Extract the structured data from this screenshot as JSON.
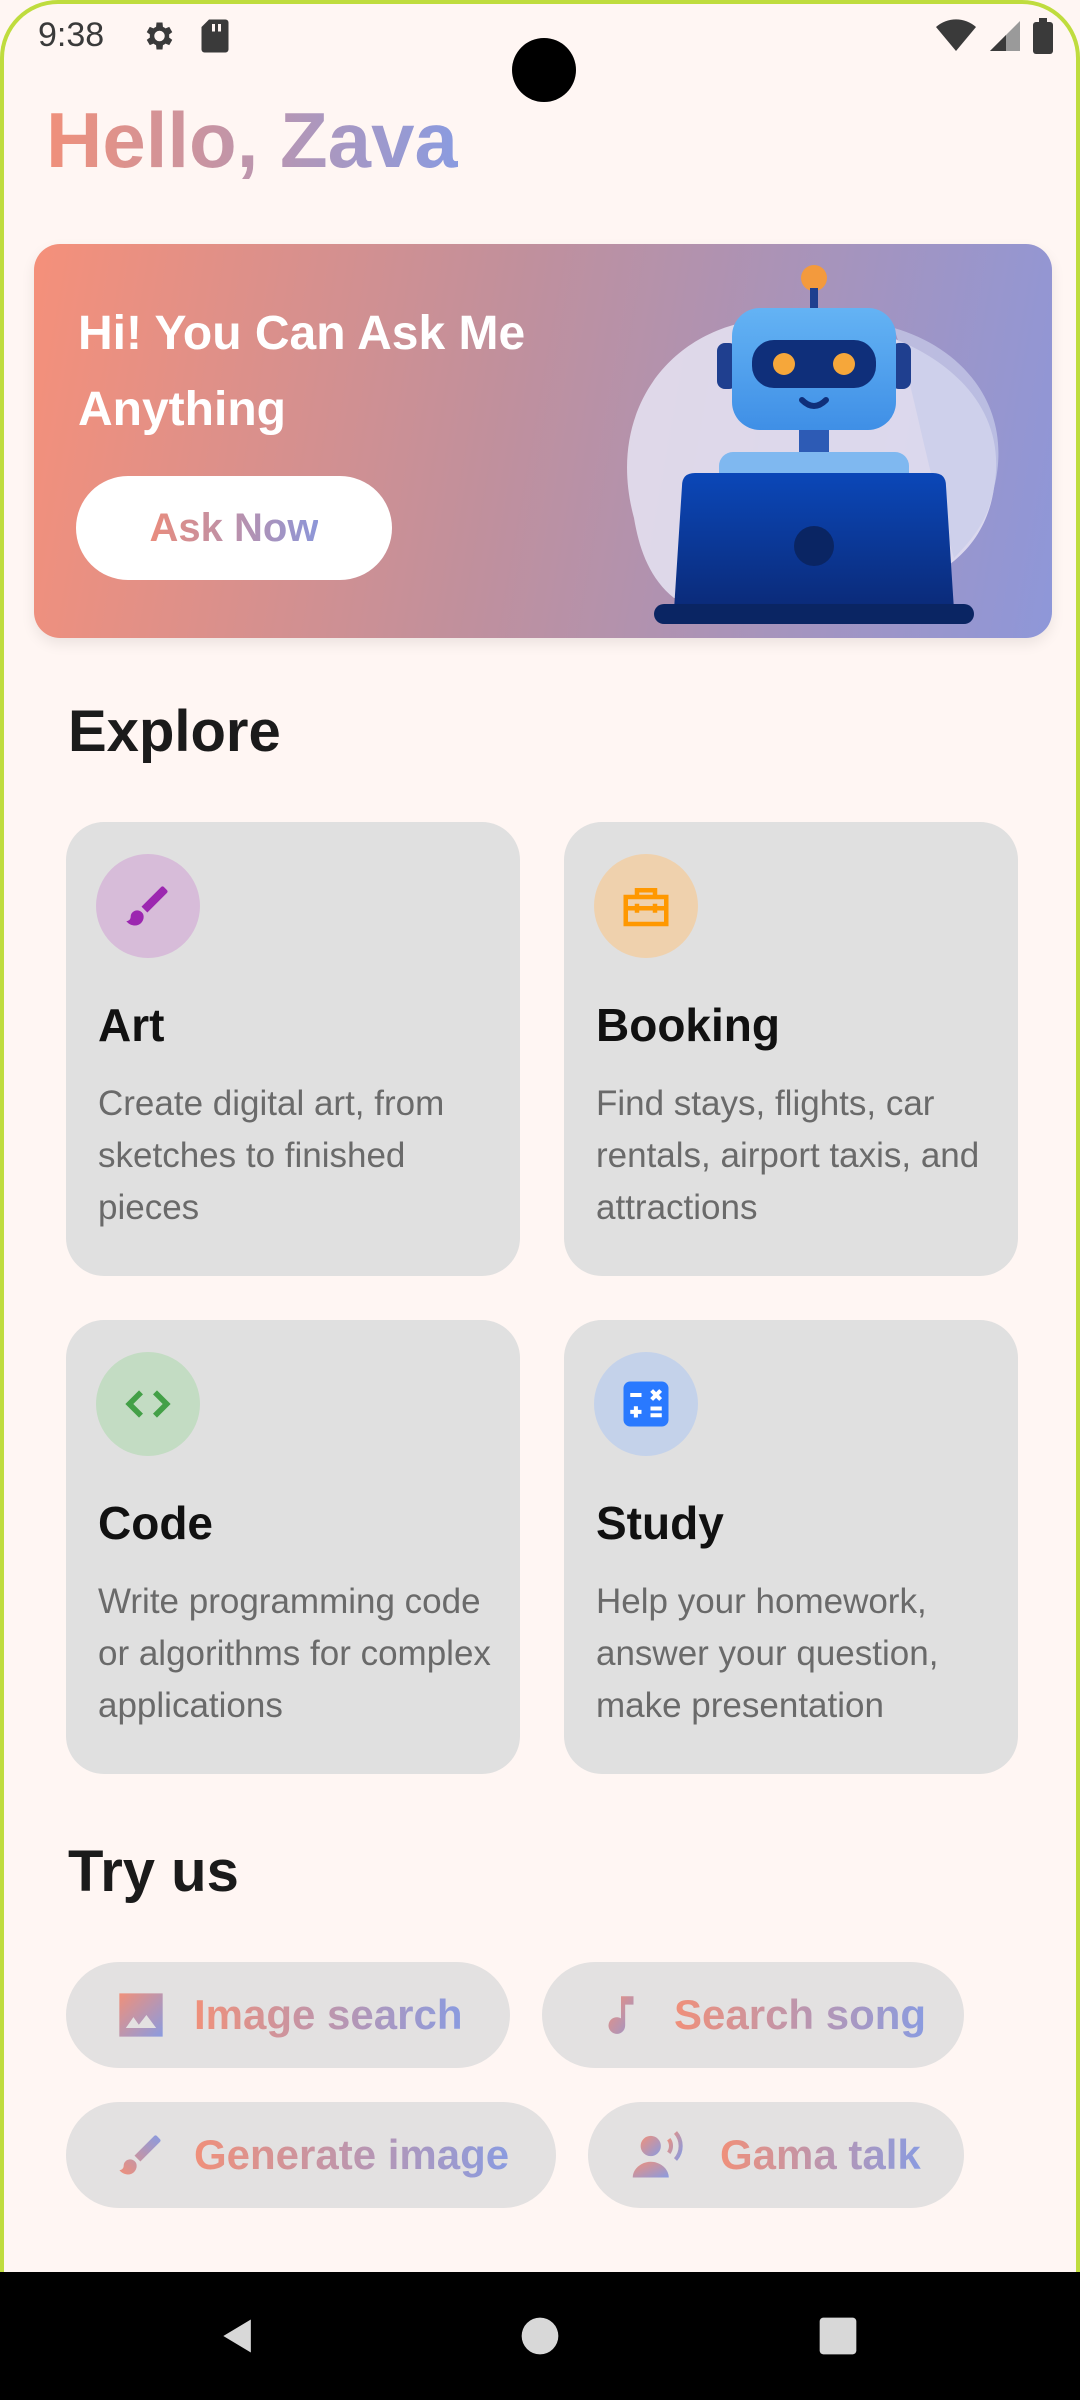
{
  "status_bar": {
    "time": "9:38"
  },
  "greeting": "Hello, Zava",
  "banner": {
    "title": "Hi! You Can Ask Me Anything",
    "button": "Ask Now"
  },
  "explore": {
    "title": "Explore",
    "cards": [
      {
        "title": "Art",
        "description": "Create digital art, from sketches to finished pieces",
        "icon": "brush-icon",
        "color": "#9c27b0"
      },
      {
        "title": "Booking",
        "description": "Find stays, flights, car rentals, airport taxis, and attractions",
        "icon": "briefcase-icon",
        "color": "#ff9800"
      },
      {
        "title": "Code",
        "description": "Write programming code or algorithms for complex applications",
        "icon": "code-icon",
        "color": "#4caf50"
      },
      {
        "title": "Study",
        "description": "Help your homework, answer your question, make presentation",
        "icon": "calculator-icon",
        "color": "#2979ff"
      }
    ]
  },
  "try_us": {
    "title": "Try us",
    "chips": [
      {
        "label": "Image search",
        "icon": "image-icon"
      },
      {
        "label": "Search song",
        "icon": "music-note-icon"
      },
      {
        "label": "Generate image",
        "icon": "brush-icon"
      },
      {
        "label": "Gama talk",
        "icon": "voice-person-icon"
      }
    ]
  }
}
